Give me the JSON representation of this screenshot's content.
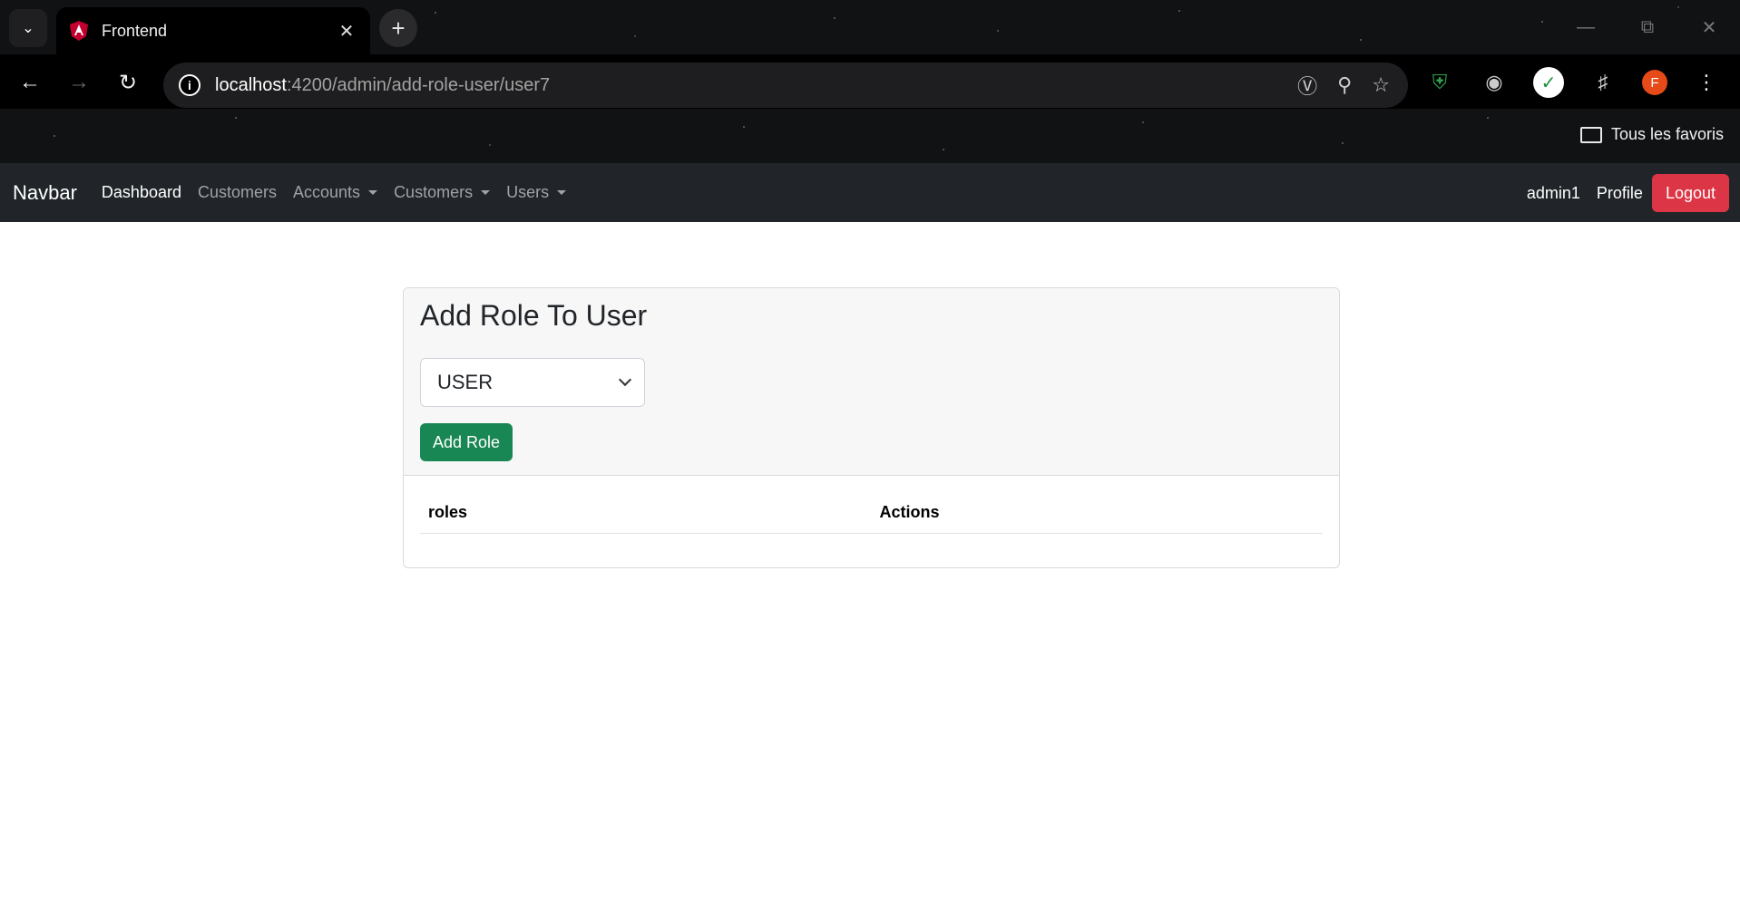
{
  "browser": {
    "tab_title": "Frontend",
    "url_host": "localhost",
    "url_path": ":4200/admin/add-role-user/user7",
    "bookmarks_label": "Tous les favoris",
    "profile_initial": "F"
  },
  "navbar": {
    "brand": "Navbar",
    "links": [
      "Dashboard",
      "Customers",
      "Accounts",
      "Customers",
      "Users"
    ],
    "username": "admin1",
    "profile": "Profile",
    "logout": "Logout"
  },
  "card": {
    "title": "Add Role To User",
    "selected_role": "USER",
    "add_button": "Add Role",
    "table_headers": [
      "roles",
      "Actions"
    ]
  },
  "colors": {
    "navbar_bg": "#212529",
    "logout": "#dc3545",
    "add_button": "#198754"
  }
}
